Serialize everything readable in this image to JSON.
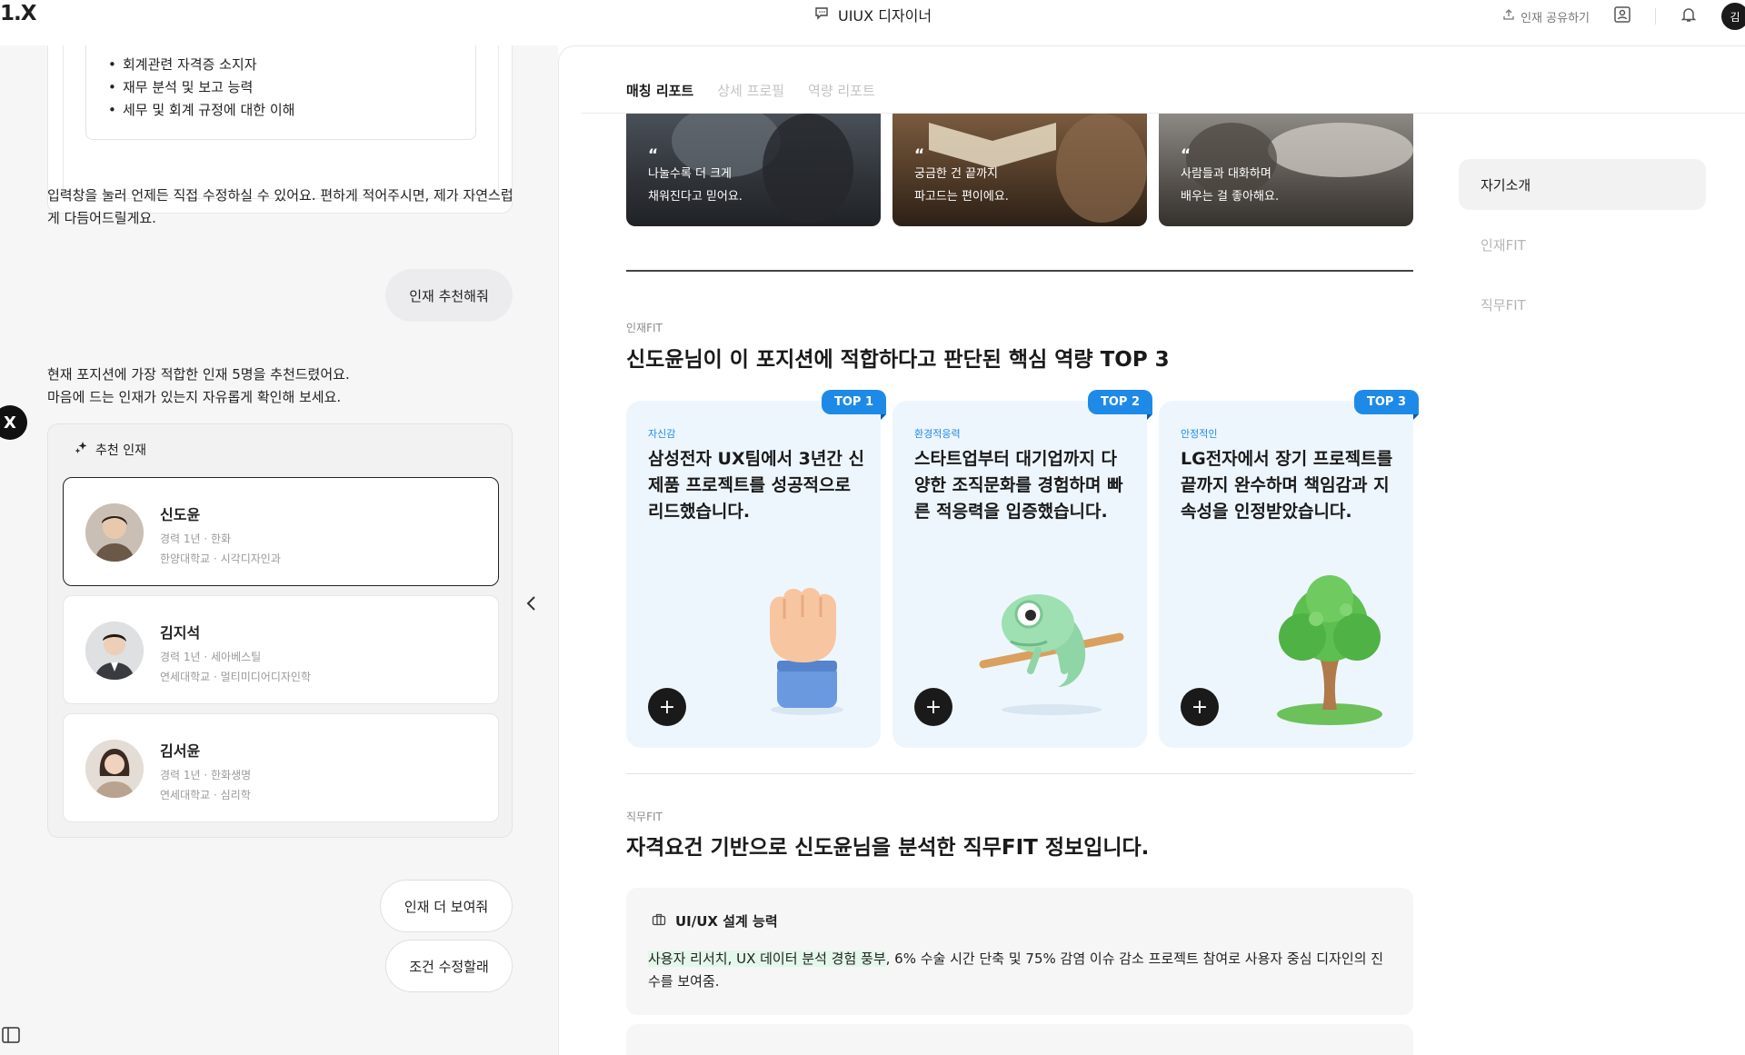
{
  "topbar": {
    "logo": "1.X",
    "room_title": "UIUX 디자이너",
    "share_label": "인재 공유하기",
    "avatar_initial": "김"
  },
  "chat": {
    "requirements": [
      "회계관련 자격증 소지자",
      "재무 분석 및 보고 능력",
      "세무 및 회계 규정에 대한 이해"
    ],
    "assistant_msg_1": "입력창을 눌러 언제든 직접 수정하실 수 있어요. 편하게 적어주시면, 제가 자연스럽게 다듬어드릴게요.",
    "user_msg_1": "인재 추천해줘",
    "assistant_msg_2_line1": "현재 포지션에 가장 적합한 인재 5명을 추천드렸어요.",
    "assistant_msg_2_line2": "마음에 드는 인재가 있는지 자유롭게 확인해 보세요.",
    "close_label": "X",
    "rec_title": "추천 인재",
    "candidates": [
      {
        "name": "신도윤",
        "career": "경력 1년 · 한화",
        "edu": "한양대학교 · 시각디자인과"
      },
      {
        "name": "김지석",
        "career": "경력 1년 · 세아베스틸",
        "edu": "연세대학교 · 멀티미디어디자인학"
      },
      {
        "name": "김서윤",
        "career": "경력 1년 · 한화생명",
        "edu": "연세대학교 · 심리학"
      }
    ],
    "user_msg_2": "인재 더 보여줘",
    "user_msg_3": "조건 수정할래"
  },
  "report": {
    "tabs": [
      "매칭 리포트",
      "상세 프로필",
      "역량 리포트"
    ],
    "quotes": [
      {
        "line1": "나눌수록 더 크게",
        "line2": "채워진다고 믿어요."
      },
      {
        "line1": "궁금한 건 끝까지",
        "line2": "파고드는 편이에요."
      },
      {
        "line1": "사람들과 대화하며",
        "line2": "배우는 걸 좋아해요."
      }
    ],
    "fit_label": "인재FIT",
    "fit_title": "신도윤님이 이 포지션에 적합하다고 판단된 핵심 역량 TOP 3",
    "fit_cards": [
      {
        "badge": "TOP 1",
        "tag": "자신감",
        "desc": "삼성전자 UX팀에서 3년간 신제품 프로젝트를 성공적으로 리드했습니다."
      },
      {
        "badge": "TOP 2",
        "tag": "환경적응력",
        "desc": "스타트업부터 대기업까지 다양한 조직문화를 경험하며 빠른 적응력을 입증했습니다."
      },
      {
        "badge": "TOP 3",
        "tag": "안정적인",
        "desc": "LG전자에서 장기 프로젝트를 끝까지 완수하며 책임감과 지속성을 인정받았습니다."
      }
    ],
    "job_label": "직무FIT",
    "job_title": "자격요건 기반으로 신도윤님을 분석한 직무FIT 정보입니다.",
    "job_card": {
      "heading": "UI/UX 설계 능력",
      "highlight": "사용자 리서치, UX 데이터 분석 경험 풍부",
      "rest": ", 6% 수술 시간 단축 및 75% 감염 이슈 감소 프로젝트 참여로 사용자 중심 디자인의 진수를 보여줌."
    },
    "side_nav": [
      "자기소개",
      "인재FIT",
      "직무FIT"
    ]
  }
}
